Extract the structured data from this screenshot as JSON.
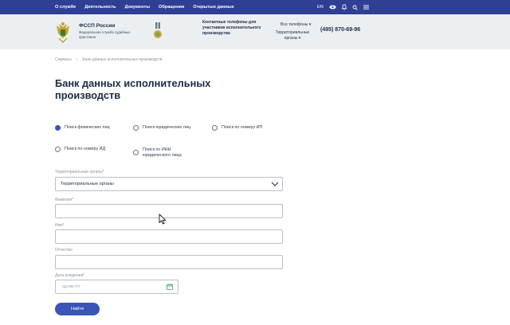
{
  "topbar": {
    "nav": [
      "О службе",
      "Деятельность",
      "Документы",
      "Обращения",
      "Открытые данные"
    ],
    "lang": "EN"
  },
  "header": {
    "brand_title": "ФССП России",
    "brand_subtitle": "Федеральная служба судебных приставов",
    "contacts_title": "Контактные телефоны для участников исполнительного производства",
    "phones_all": "Все телефоны",
    "phones_territorial": "Территориальные органы",
    "phone": "(495) 870-69-96"
  },
  "breadcrumb": [
    "Сервисы",
    "Банк данных исполнительных производств"
  ],
  "page": {
    "title": "Банк данных исполнительных производств"
  },
  "search_types": [
    {
      "label": "Поиск физических лиц",
      "selected": true
    },
    {
      "label": "Поиск юридических лиц",
      "selected": false
    },
    {
      "label": "Поиск по номеру ИП",
      "selected": false
    },
    {
      "label": "Поиск по номеру ИД",
      "selected": false
    },
    {
      "label": "Поиск по ИНН юридического лица",
      "selected": false
    }
  ],
  "form": {
    "territorial_label": "Территориальные органы*",
    "territorial_value": "Территориальные органы",
    "lastname_label": "Фамилия*",
    "firstname_label": "Имя*",
    "patronymic_label": "Отчество",
    "birthdate_label": "Дата рождения*",
    "birthdate_placeholder": "дд.мм.гггг",
    "submit": "Найти"
  }
}
